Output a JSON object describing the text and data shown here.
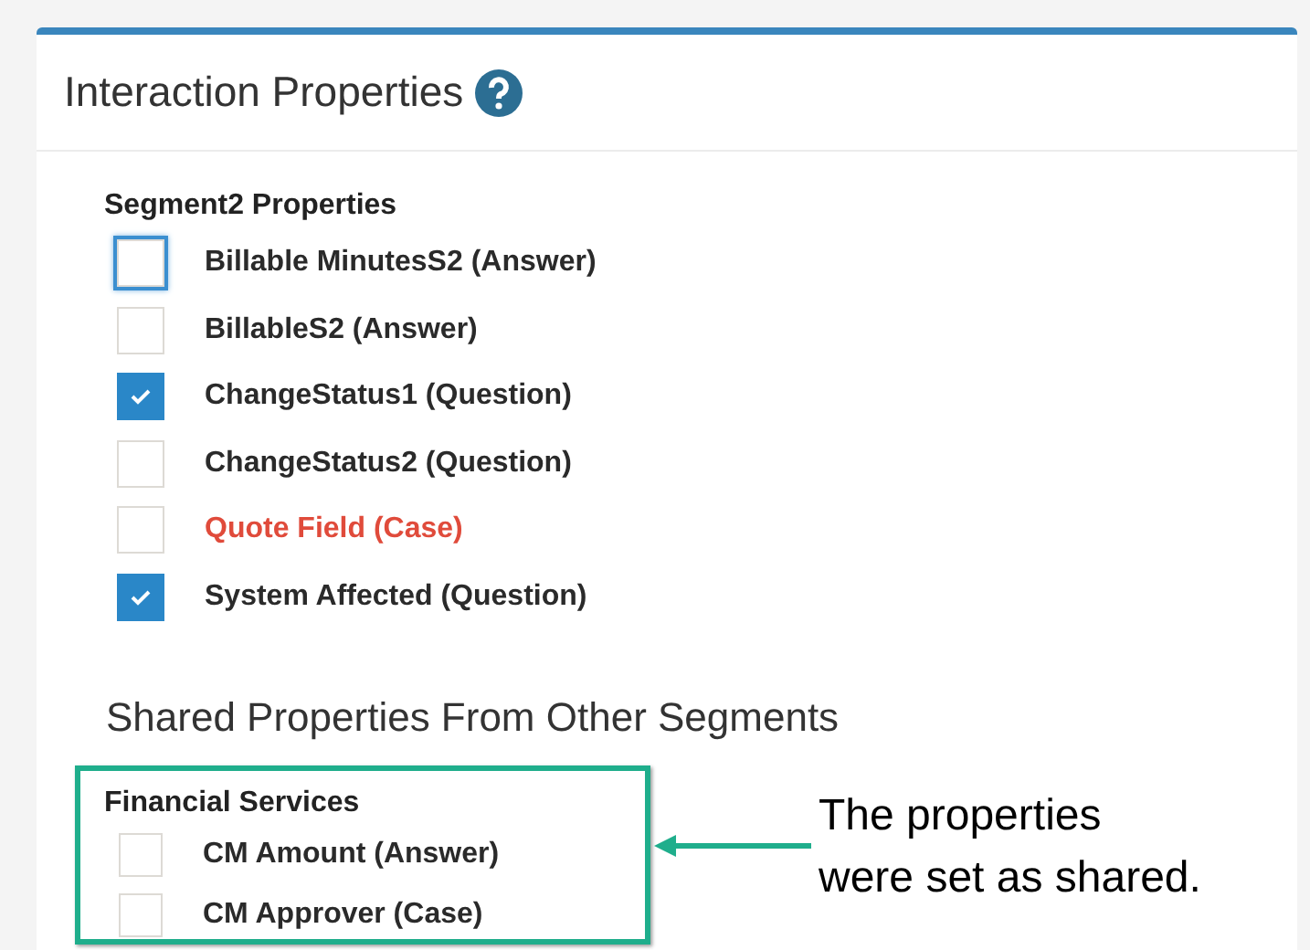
{
  "panel": {
    "title": "Interaction Properties"
  },
  "segment": {
    "title": "Segment2 Properties",
    "items": [
      {
        "label": "Billable MinutesS2 (Answer)",
        "checked": false,
        "focused": true,
        "error": false
      },
      {
        "label": "BillableS2 (Answer)",
        "checked": false,
        "focused": false,
        "error": false
      },
      {
        "label": "ChangeStatus1 (Question)",
        "checked": true,
        "focused": false,
        "error": false
      },
      {
        "label": "ChangeStatus2 (Question)",
        "checked": false,
        "focused": false,
        "error": false
      },
      {
        "label": "Quote Field (Case)",
        "checked": false,
        "focused": false,
        "error": true
      },
      {
        "label": "System Affected (Question)",
        "checked": true,
        "focused": false,
        "error": false
      }
    ]
  },
  "shared": {
    "title": "Shared Properties From Other Segments",
    "groups": [
      {
        "title": "Financial Services",
        "items": [
          {
            "label": "CM Amount (Answer)",
            "checked": false
          },
          {
            "label": "CM Approver (Case)",
            "checked": false
          }
        ]
      }
    ]
  },
  "callout": {
    "lines": [
      "The properties",
      "were set as shared."
    ]
  }
}
